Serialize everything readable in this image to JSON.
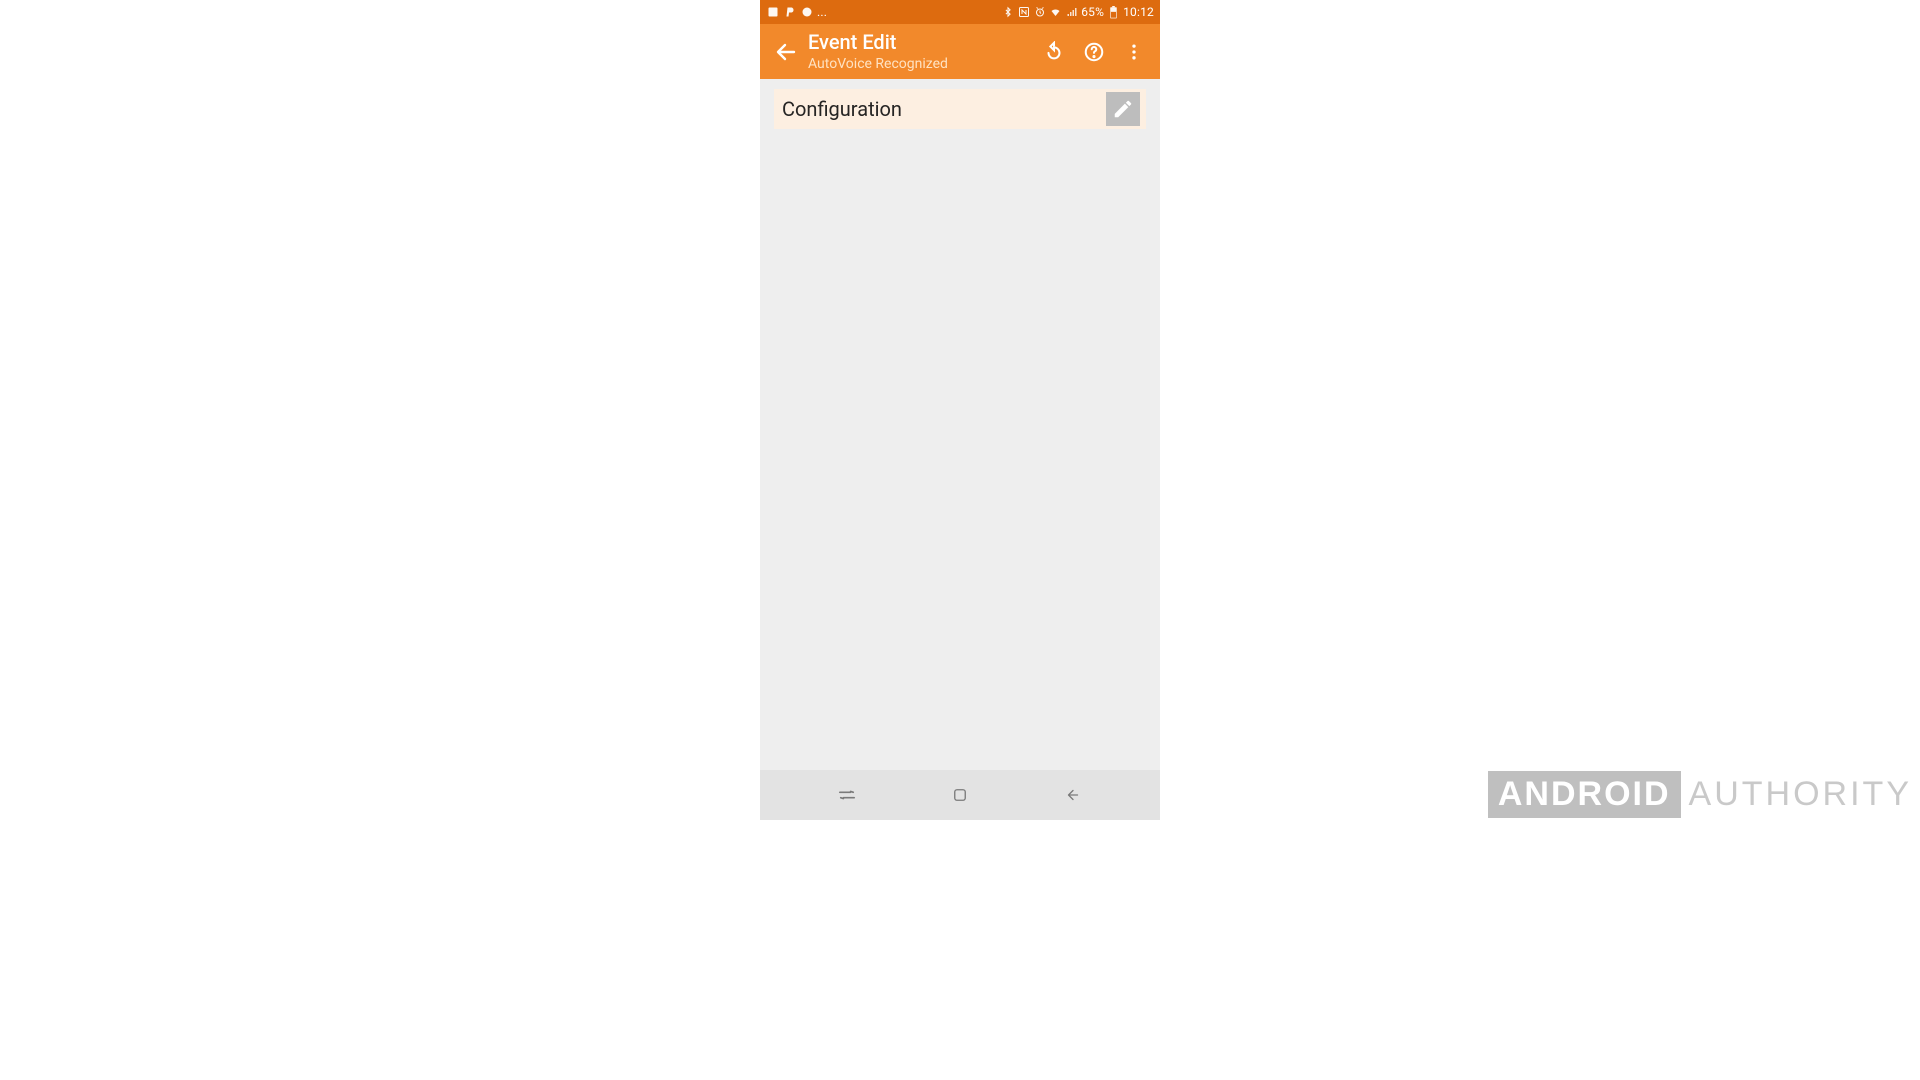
{
  "status_bar": {
    "ellipsis": "...",
    "battery_text": "65%",
    "time": "10:12"
  },
  "app_bar": {
    "title": "Event Edit",
    "subtitle": "AutoVoice Recognized"
  },
  "content": {
    "configuration_label": "Configuration"
  },
  "watermark": {
    "brand_boxed": "ANDROID",
    "brand_rest": "AUTHORITY"
  }
}
